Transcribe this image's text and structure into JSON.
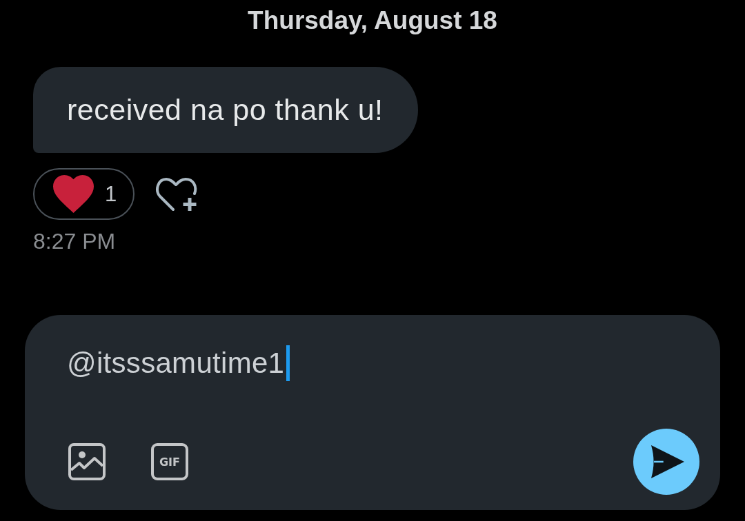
{
  "date_header": "Thursday, August 18",
  "messages": [
    {
      "text": "received na po thank u!",
      "reactions": [
        {
          "count": "1"
        }
      ],
      "time": "8:27 PM"
    }
  ],
  "composer": {
    "value": "@itsssamutime1",
    "focused": true,
    "gif_button": "GIF"
  }
}
